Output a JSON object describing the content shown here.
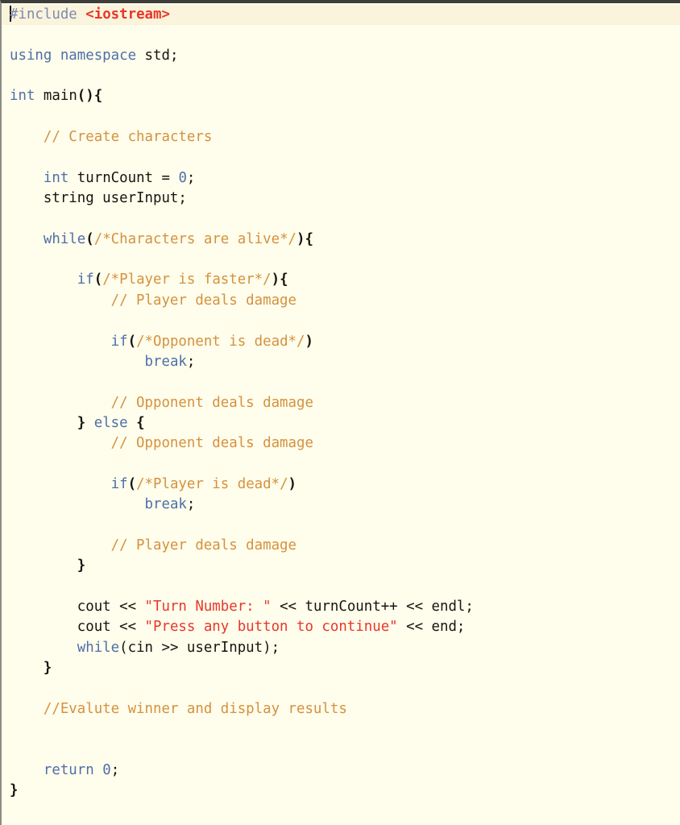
{
  "editor": {
    "language": "C++",
    "background_color": "#fffdec",
    "current_line_color": "#fbf4dc",
    "caret_line": 1,
    "caret_column": 1,
    "colors": {
      "plain": "#15150f",
      "keyword": "#4f6fa8",
      "preprocessor": "#7f8aad",
      "include_header": "#e8372a",
      "string": "#e8372a",
      "comment": "#d4923f",
      "number": "#4f6fa8"
    },
    "lines": [
      {
        "n": 1,
        "current": true,
        "caret": true,
        "tokens": [
          {
            "c": "pre",
            "t": "#include"
          },
          {
            "c": "plain",
            "t": " "
          },
          {
            "c": "inc",
            "t": "<iostream>"
          }
        ]
      },
      {
        "n": 2,
        "tokens": []
      },
      {
        "n": 3,
        "tokens": [
          {
            "c": "kw",
            "t": "using namespace"
          },
          {
            "c": "plain",
            "t": " std;"
          }
        ]
      },
      {
        "n": 4,
        "tokens": []
      },
      {
        "n": 5,
        "tokens": [
          {
            "c": "kw",
            "t": "int"
          },
          {
            "c": "plain",
            "t": " "
          },
          {
            "c": "plain",
            "t": "main"
          },
          {
            "c": "brace",
            "t": "(){"
          }
        ]
      },
      {
        "n": 6,
        "tokens": []
      },
      {
        "n": 7,
        "tokens": [
          {
            "c": "plain",
            "t": "    "
          },
          {
            "c": "com",
            "t": "// Create characters"
          }
        ]
      },
      {
        "n": 8,
        "tokens": []
      },
      {
        "n": 9,
        "tokens": [
          {
            "c": "plain",
            "t": "    "
          },
          {
            "c": "kw",
            "t": "int"
          },
          {
            "c": "plain",
            "t": " turnCount = "
          },
          {
            "c": "num",
            "t": "0"
          },
          {
            "c": "plain",
            "t": ";"
          }
        ]
      },
      {
        "n": 10,
        "tokens": [
          {
            "c": "plain",
            "t": "    string userInput;"
          }
        ]
      },
      {
        "n": 11,
        "tokens": []
      },
      {
        "n": 12,
        "tokens": [
          {
            "c": "plain",
            "t": "    "
          },
          {
            "c": "kw",
            "t": "while"
          },
          {
            "c": "brace",
            "t": "("
          },
          {
            "c": "com",
            "t": "/*Characters are alive*/"
          },
          {
            "c": "brace",
            "t": "){"
          }
        ]
      },
      {
        "n": 13,
        "tokens": []
      },
      {
        "n": 14,
        "tokens": [
          {
            "c": "plain",
            "t": "        "
          },
          {
            "c": "kw",
            "t": "if"
          },
          {
            "c": "brace",
            "t": "("
          },
          {
            "c": "com",
            "t": "/*Player is faster*/"
          },
          {
            "c": "brace",
            "t": "){"
          }
        ]
      },
      {
        "n": 15,
        "tokens": [
          {
            "c": "plain",
            "t": "            "
          },
          {
            "c": "com",
            "t": "// Player deals damage"
          }
        ]
      },
      {
        "n": 16,
        "tokens": []
      },
      {
        "n": 17,
        "tokens": [
          {
            "c": "plain",
            "t": "            "
          },
          {
            "c": "kw",
            "t": "if"
          },
          {
            "c": "brace",
            "t": "("
          },
          {
            "c": "com",
            "t": "/*Opponent is dead*/"
          },
          {
            "c": "brace",
            "t": ")"
          }
        ]
      },
      {
        "n": 18,
        "tokens": [
          {
            "c": "plain",
            "t": "                "
          },
          {
            "c": "kw",
            "t": "break"
          },
          {
            "c": "plain",
            "t": ";"
          }
        ]
      },
      {
        "n": 19,
        "tokens": []
      },
      {
        "n": 20,
        "tokens": [
          {
            "c": "plain",
            "t": "            "
          },
          {
            "c": "com",
            "t": "// Opponent deals damage"
          }
        ]
      },
      {
        "n": 21,
        "tokens": [
          {
            "c": "plain",
            "t": "        "
          },
          {
            "c": "brace",
            "t": "}"
          },
          {
            "c": "plain",
            "t": " "
          },
          {
            "c": "kw",
            "t": "else"
          },
          {
            "c": "plain",
            "t": " "
          },
          {
            "c": "brace",
            "t": "{"
          }
        ]
      },
      {
        "n": 22,
        "tokens": [
          {
            "c": "plain",
            "t": "            "
          },
          {
            "c": "com",
            "t": "// Opponent deals damage"
          }
        ]
      },
      {
        "n": 23,
        "tokens": []
      },
      {
        "n": 24,
        "tokens": [
          {
            "c": "plain",
            "t": "            "
          },
          {
            "c": "kw",
            "t": "if"
          },
          {
            "c": "brace",
            "t": "("
          },
          {
            "c": "com",
            "t": "/*Player is dead*/"
          },
          {
            "c": "brace",
            "t": ")"
          }
        ]
      },
      {
        "n": 25,
        "tokens": [
          {
            "c": "plain",
            "t": "                "
          },
          {
            "c": "kw",
            "t": "break"
          },
          {
            "c": "plain",
            "t": ";"
          }
        ]
      },
      {
        "n": 26,
        "tokens": []
      },
      {
        "n": 27,
        "tokens": [
          {
            "c": "plain",
            "t": "            "
          },
          {
            "c": "com",
            "t": "// Player deals damage"
          }
        ]
      },
      {
        "n": 28,
        "tokens": [
          {
            "c": "plain",
            "t": "        "
          },
          {
            "c": "brace",
            "t": "}"
          }
        ]
      },
      {
        "n": 29,
        "tokens": []
      },
      {
        "n": 30,
        "tokens": [
          {
            "c": "plain",
            "t": "        cout << "
          },
          {
            "c": "str",
            "t": "\"Turn Number: \""
          },
          {
            "c": "plain",
            "t": " << turnCount++ << endl;"
          }
        ]
      },
      {
        "n": 31,
        "tokens": [
          {
            "c": "plain",
            "t": "        cout << "
          },
          {
            "c": "str",
            "t": "\"Press any button to continue\""
          },
          {
            "c": "plain",
            "t": " << end;"
          }
        ]
      },
      {
        "n": 32,
        "tokens": [
          {
            "c": "plain",
            "t": "        "
          },
          {
            "c": "kw",
            "t": "while"
          },
          {
            "c": "plain",
            "t": "(cin >> userInput);"
          }
        ]
      },
      {
        "n": 33,
        "tokens": [
          {
            "c": "plain",
            "t": "    "
          },
          {
            "c": "brace",
            "t": "}"
          }
        ]
      },
      {
        "n": 34,
        "tokens": []
      },
      {
        "n": 35,
        "tokens": [
          {
            "c": "plain",
            "t": "    "
          },
          {
            "c": "com",
            "t": "//Evalute winner and display results"
          }
        ]
      },
      {
        "n": 36,
        "tokens": []
      },
      {
        "n": 37,
        "tokens": []
      },
      {
        "n": 38,
        "tokens": [
          {
            "c": "plain",
            "t": "    "
          },
          {
            "c": "kw",
            "t": "return"
          },
          {
            "c": "plain",
            "t": " "
          },
          {
            "c": "num",
            "t": "0"
          },
          {
            "c": "plain",
            "t": ";"
          }
        ]
      },
      {
        "n": 39,
        "tokens": [
          {
            "c": "brace",
            "t": "}"
          }
        ]
      },
      {
        "n": 40,
        "tokens": []
      }
    ]
  }
}
